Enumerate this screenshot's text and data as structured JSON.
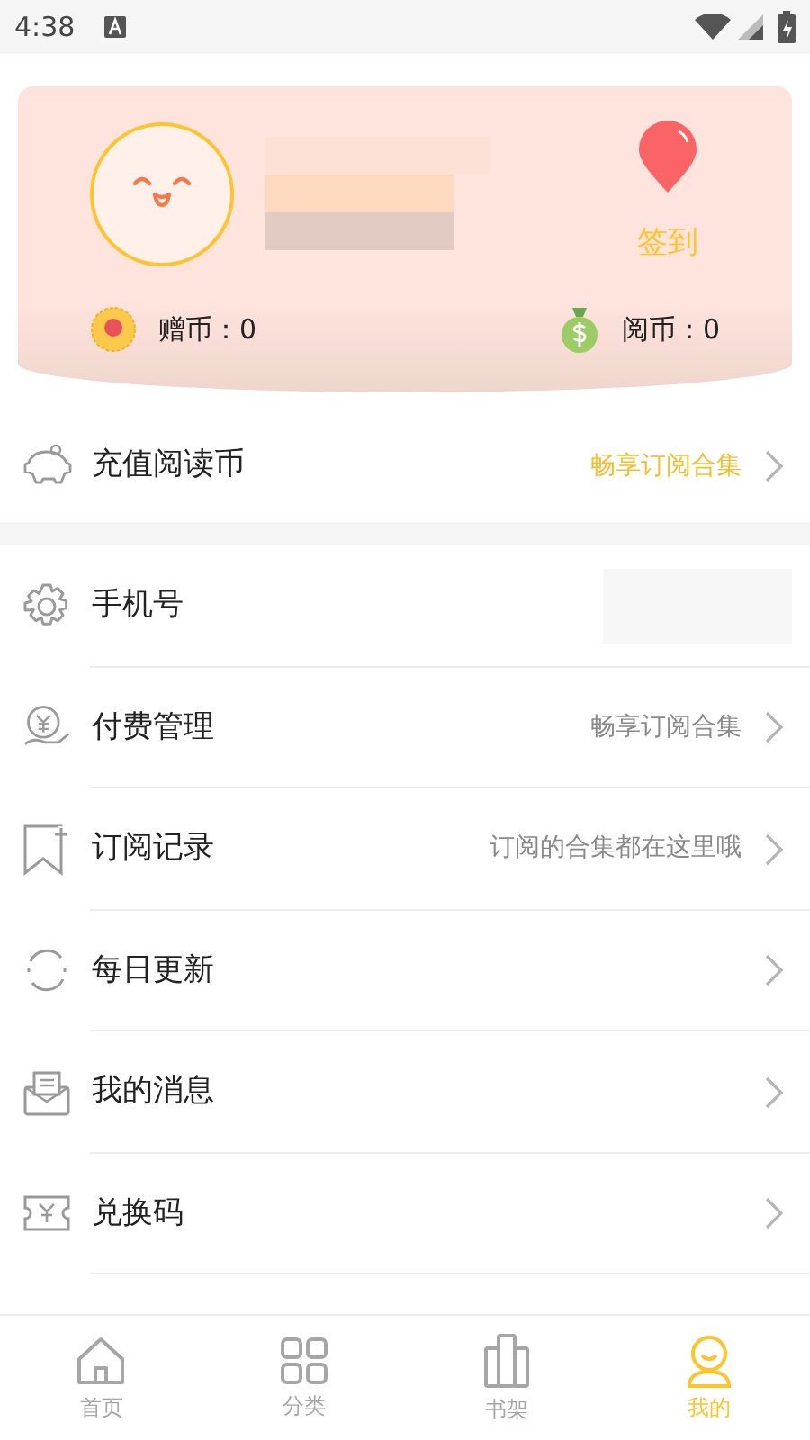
{
  "status_bar": {
    "time": "4:38"
  },
  "profile": {
    "checkin_label": "签到",
    "coins": [
      {
        "label": "赠币：",
        "value": "0"
      },
      {
        "label": "阅币：",
        "value": "0"
      }
    ]
  },
  "recharge": {
    "label": "充值阅读币",
    "note": "畅享订阅合集",
    "highlighted": true
  },
  "menu": [
    {
      "kind": "info",
      "label": "手机号"
    },
    {
      "kind": "link",
      "label": "付费管理",
      "note": "畅享订阅合集",
      "highlighted": false
    },
    {
      "kind": "link",
      "label": "订阅记录",
      "note": "订阅的合集都在这里哦",
      "highlighted": false
    },
    {
      "kind": "link",
      "label": "每日更新"
    },
    {
      "kind": "link",
      "label": "我的消息"
    },
    {
      "kind": "link",
      "label": "兑换码"
    }
  ],
  "tabs": [
    {
      "label": "首页",
      "selected": false
    },
    {
      "label": "分类",
      "selected": false
    },
    {
      "label": "书架",
      "selected": false
    },
    {
      "label": "我的",
      "selected": true
    }
  ]
}
